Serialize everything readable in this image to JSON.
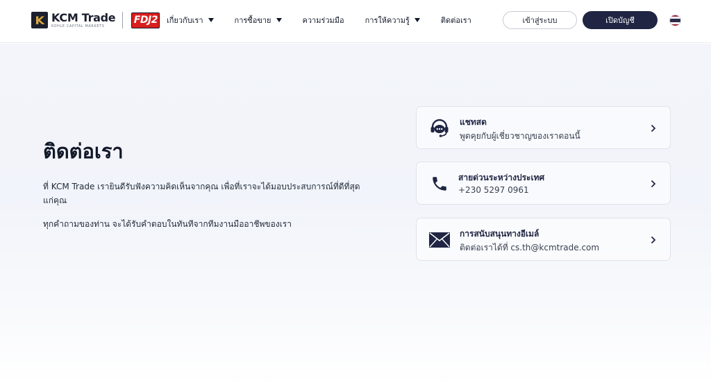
{
  "header": {
    "logo_name": "KCM Trade",
    "logo_subtitle": "KOHLE CAPITAL MARKETS",
    "partner_logo": "FDJ2",
    "nav": [
      {
        "label": "เกี่ยวกับเรา",
        "has_dropdown": true
      },
      {
        "label": "การซื้อขาย",
        "has_dropdown": true
      },
      {
        "label": "ความร่วมมือ",
        "has_dropdown": false
      },
      {
        "label": "การให้ความรู้",
        "has_dropdown": true
      },
      {
        "label": "ติดต่อเรา",
        "has_dropdown": false
      }
    ],
    "login_label": "เข้าสู่ระบบ",
    "open_account_label": "เปิดบัญชี",
    "language_flag": "thailand-flag-icon"
  },
  "main": {
    "title": "ติดต่อเรา",
    "paragraph1": "ที่ KCM Trade เรายินดีรับฟังความคิดเห็นจากคุณ เพื่อที่เราจะได้มอบประสบการณ์ที่ดีที่สุดแก่คุณ",
    "paragraph2": "ทุกคำถามของท่าน จะได้รับคำตอบในทันทีจากทีมงานมืออาชีพของเรา",
    "cards": [
      {
        "title": "แชทสด",
        "subtitle": "พูดคุยกับผู้เชี่ยวชาญของเราตอนนี้",
        "icon": "headset-chat-icon"
      },
      {
        "title": "สายด่วนระหว่างประเทศ",
        "subtitle": "+230 5297 0961",
        "icon": "phone-icon"
      },
      {
        "title": "การสนับสนุนทางอีเมล์",
        "subtitle": "ติดต่อเราได้ที่ cs.th@kcmtrade.com",
        "icon": "email-icon"
      }
    ]
  },
  "colors": {
    "primary_dark": "#1f2542",
    "logo_gold": "#d8a640",
    "partner_red": "#d81e1e",
    "background": "#f3f5fa"
  }
}
